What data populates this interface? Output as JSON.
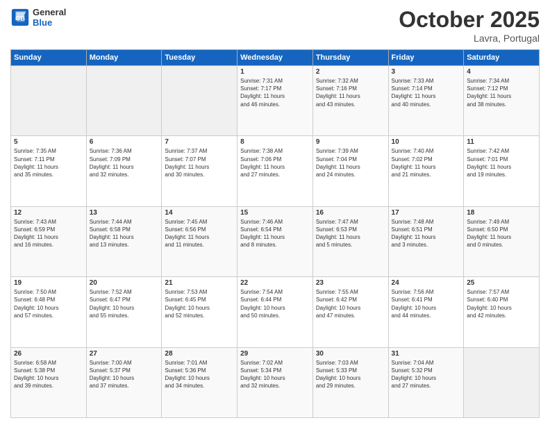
{
  "header": {
    "logo_line1": "General",
    "logo_line2": "Blue",
    "month": "October 2025",
    "location": "Lavra, Portugal"
  },
  "days_of_week": [
    "Sunday",
    "Monday",
    "Tuesday",
    "Wednesday",
    "Thursday",
    "Friday",
    "Saturday"
  ],
  "weeks": [
    [
      {
        "day": "",
        "info": ""
      },
      {
        "day": "",
        "info": ""
      },
      {
        "day": "",
        "info": ""
      },
      {
        "day": "1",
        "info": "Sunrise: 7:31 AM\nSunset: 7:17 PM\nDaylight: 11 hours\nand 46 minutes."
      },
      {
        "day": "2",
        "info": "Sunrise: 7:32 AM\nSunset: 7:16 PM\nDaylight: 11 hours\nand 43 minutes."
      },
      {
        "day": "3",
        "info": "Sunrise: 7:33 AM\nSunset: 7:14 PM\nDaylight: 11 hours\nand 40 minutes."
      },
      {
        "day": "4",
        "info": "Sunrise: 7:34 AM\nSunset: 7:12 PM\nDaylight: 11 hours\nand 38 minutes."
      }
    ],
    [
      {
        "day": "5",
        "info": "Sunrise: 7:35 AM\nSunset: 7:11 PM\nDaylight: 11 hours\nand 35 minutes."
      },
      {
        "day": "6",
        "info": "Sunrise: 7:36 AM\nSunset: 7:09 PM\nDaylight: 11 hours\nand 32 minutes."
      },
      {
        "day": "7",
        "info": "Sunrise: 7:37 AM\nSunset: 7:07 PM\nDaylight: 11 hours\nand 30 minutes."
      },
      {
        "day": "8",
        "info": "Sunrise: 7:38 AM\nSunset: 7:06 PM\nDaylight: 11 hours\nand 27 minutes."
      },
      {
        "day": "9",
        "info": "Sunrise: 7:39 AM\nSunset: 7:04 PM\nDaylight: 11 hours\nand 24 minutes."
      },
      {
        "day": "10",
        "info": "Sunrise: 7:40 AM\nSunset: 7:02 PM\nDaylight: 11 hours\nand 21 minutes."
      },
      {
        "day": "11",
        "info": "Sunrise: 7:42 AM\nSunset: 7:01 PM\nDaylight: 11 hours\nand 19 minutes."
      }
    ],
    [
      {
        "day": "12",
        "info": "Sunrise: 7:43 AM\nSunset: 6:59 PM\nDaylight: 11 hours\nand 16 minutes."
      },
      {
        "day": "13",
        "info": "Sunrise: 7:44 AM\nSunset: 6:58 PM\nDaylight: 11 hours\nand 13 minutes."
      },
      {
        "day": "14",
        "info": "Sunrise: 7:45 AM\nSunset: 6:56 PM\nDaylight: 11 hours\nand 11 minutes."
      },
      {
        "day": "15",
        "info": "Sunrise: 7:46 AM\nSunset: 6:54 PM\nDaylight: 11 hours\nand 8 minutes."
      },
      {
        "day": "16",
        "info": "Sunrise: 7:47 AM\nSunset: 6:53 PM\nDaylight: 11 hours\nand 5 minutes."
      },
      {
        "day": "17",
        "info": "Sunrise: 7:48 AM\nSunset: 6:51 PM\nDaylight: 11 hours\nand 3 minutes."
      },
      {
        "day": "18",
        "info": "Sunrise: 7:49 AM\nSunset: 6:50 PM\nDaylight: 11 hours\nand 0 minutes."
      }
    ],
    [
      {
        "day": "19",
        "info": "Sunrise: 7:50 AM\nSunset: 6:48 PM\nDaylight: 10 hours\nand 57 minutes."
      },
      {
        "day": "20",
        "info": "Sunrise: 7:52 AM\nSunset: 6:47 PM\nDaylight: 10 hours\nand 55 minutes."
      },
      {
        "day": "21",
        "info": "Sunrise: 7:53 AM\nSunset: 6:45 PM\nDaylight: 10 hours\nand 52 minutes."
      },
      {
        "day": "22",
        "info": "Sunrise: 7:54 AM\nSunset: 6:44 PM\nDaylight: 10 hours\nand 50 minutes."
      },
      {
        "day": "23",
        "info": "Sunrise: 7:55 AM\nSunset: 6:42 PM\nDaylight: 10 hours\nand 47 minutes."
      },
      {
        "day": "24",
        "info": "Sunrise: 7:56 AM\nSunset: 6:41 PM\nDaylight: 10 hours\nand 44 minutes."
      },
      {
        "day": "25",
        "info": "Sunrise: 7:57 AM\nSunset: 6:40 PM\nDaylight: 10 hours\nand 42 minutes."
      }
    ],
    [
      {
        "day": "26",
        "info": "Sunrise: 6:58 AM\nSunset: 5:38 PM\nDaylight: 10 hours\nand 39 minutes."
      },
      {
        "day": "27",
        "info": "Sunrise: 7:00 AM\nSunset: 5:37 PM\nDaylight: 10 hours\nand 37 minutes."
      },
      {
        "day": "28",
        "info": "Sunrise: 7:01 AM\nSunset: 5:36 PM\nDaylight: 10 hours\nand 34 minutes."
      },
      {
        "day": "29",
        "info": "Sunrise: 7:02 AM\nSunset: 5:34 PM\nDaylight: 10 hours\nand 32 minutes."
      },
      {
        "day": "30",
        "info": "Sunrise: 7:03 AM\nSunset: 5:33 PM\nDaylight: 10 hours\nand 29 minutes."
      },
      {
        "day": "31",
        "info": "Sunrise: 7:04 AM\nSunset: 5:32 PM\nDaylight: 10 hours\nand 27 minutes."
      },
      {
        "day": "",
        "info": ""
      }
    ]
  ]
}
